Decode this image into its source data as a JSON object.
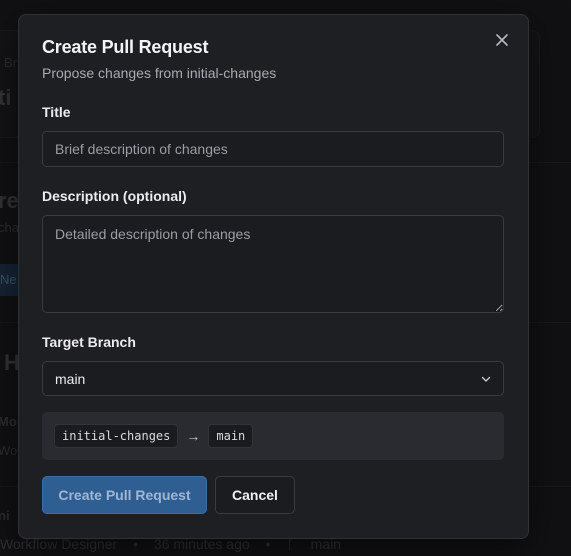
{
  "background": {
    "crumb_fragment": "Br",
    "title_fragment": "ti",
    "section_fragment": "re",
    "section_sub_fragment": "cha",
    "button_fragment": "Ne",
    "heading_fragment": "H",
    "row_fragment_1": "Mo",
    "row_fragment_2": "Wo",
    "item_fragment": "ni",
    "footer": {
      "app": "Workflow Designer",
      "time": "36 minutes ago",
      "branch": "main"
    }
  },
  "modal": {
    "title": "Create Pull Request",
    "subtitle": "Propose changes from initial-changes",
    "close_icon": "close-icon",
    "title_field": {
      "label": "Title",
      "placeholder": "Brief description of changes",
      "value": ""
    },
    "description_field": {
      "label": "Description (optional)",
      "placeholder": "Detailed description of changes",
      "value": ""
    },
    "target_branch": {
      "label": "Target Branch",
      "selected": "main"
    },
    "branch_summary": {
      "source": "initial-changes",
      "arrow": "→",
      "target": "main"
    },
    "actions": {
      "create": "Create Pull Request",
      "cancel": "Cancel"
    }
  },
  "colors": {
    "primary": "#2f5e93",
    "surface": "#1e1f23",
    "background": "#15161a"
  }
}
